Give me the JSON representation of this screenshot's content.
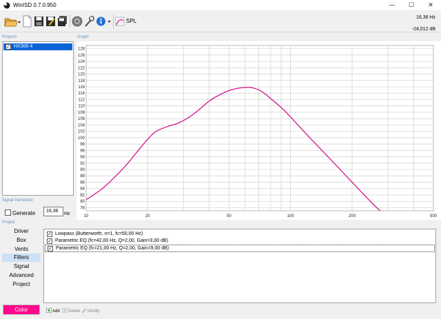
{
  "window": {
    "title": "WinISD 0.7.0.950",
    "minimize_glyph": "—",
    "maximize_glyph": "☐",
    "close_glyph": "✕"
  },
  "toolbar": {
    "spl_label": "SPL",
    "readout_frequency": "16,36 Hz",
    "readout_level": "-24,012 dB"
  },
  "sections": {
    "projects": "Projects",
    "graph": "Graph",
    "signal_generator": "Signal Generator",
    "project": "Project"
  },
  "projects": [
    {
      "name": "HX300 4",
      "checked": true,
      "check_glyph": "✓"
    }
  ],
  "signal_generator": {
    "generate_label": "Generate",
    "generate_checked": false,
    "frequency_value": "16,36",
    "frequency_unit": "Hz"
  },
  "nav": {
    "items": [
      "Driver",
      "Box",
      "Vents",
      "Filters",
      "Signal",
      "Advanced",
      "Project"
    ],
    "active": "Filters"
  },
  "filters": [
    {
      "text": "Lowpass (Butterworth, n=1, fc=50,00 Hz)",
      "checked": true,
      "check_glyph": "✓"
    },
    {
      "text": "Parametric EQ (fc=42,00 Hz, Q=2,00, Gain=3,00 dB)",
      "checked": true,
      "check_glyph": "✓"
    },
    {
      "text": "Parametric EQ (fc=21,00 Hz, Q=2,00, Gain=9,00 dB)",
      "checked": true,
      "check_glyph": "✓"
    }
  ],
  "actions": {
    "add": "Add",
    "delete": "Delete",
    "modify": "Modify"
  },
  "color_button": "Color",
  "colors": {
    "curve": "#d4148c",
    "project_color": "#ff0a8c",
    "selection": "#0a64d8"
  },
  "icons": [
    "app-logo-icon",
    "open-folder-icon",
    "new-document-icon",
    "save-icon",
    "save-as-icon",
    "save-all-icon",
    "driver-editor-icon",
    "tools-icon",
    "info-icon",
    "spl-graph-icon"
  ],
  "chart_data": {
    "type": "line",
    "x_scale": "log",
    "xlim": [
      10,
      500
    ],
    "ylim": [
      77,
      129
    ],
    "x_ticks": [
      10,
      20,
      50,
      100,
      200,
      500
    ],
    "y_ticks": [
      78,
      80,
      82,
      84,
      86,
      88,
      90,
      92,
      94,
      96,
      98,
      100,
      102,
      104,
      106,
      108,
      110,
      112,
      114,
      116,
      118,
      120,
      122,
      124,
      126,
      128
    ],
    "grid": true,
    "series": [
      {
        "x": [
          10,
          12,
          14,
          16,
          18,
          20,
          22,
          25,
          28,
          32,
          36,
          40,
          45,
          50,
          55,
          60,
          65,
          70,
          75,
          80,
          90,
          100,
          120,
          150,
          200,
          250,
          280
        ],
        "y": [
          80.5,
          84.0,
          88.0,
          92.0,
          96.0,
          99.5,
          102.0,
          103.5,
          104.5,
          106.5,
          109.0,
          111.5,
          113.5,
          114.8,
          115.5,
          115.8,
          115.7,
          115.0,
          113.8,
          112.3,
          109.5,
          106.5,
          101.0,
          94.5,
          86.0,
          79.5,
          76.5
        ]
      }
    ]
  }
}
